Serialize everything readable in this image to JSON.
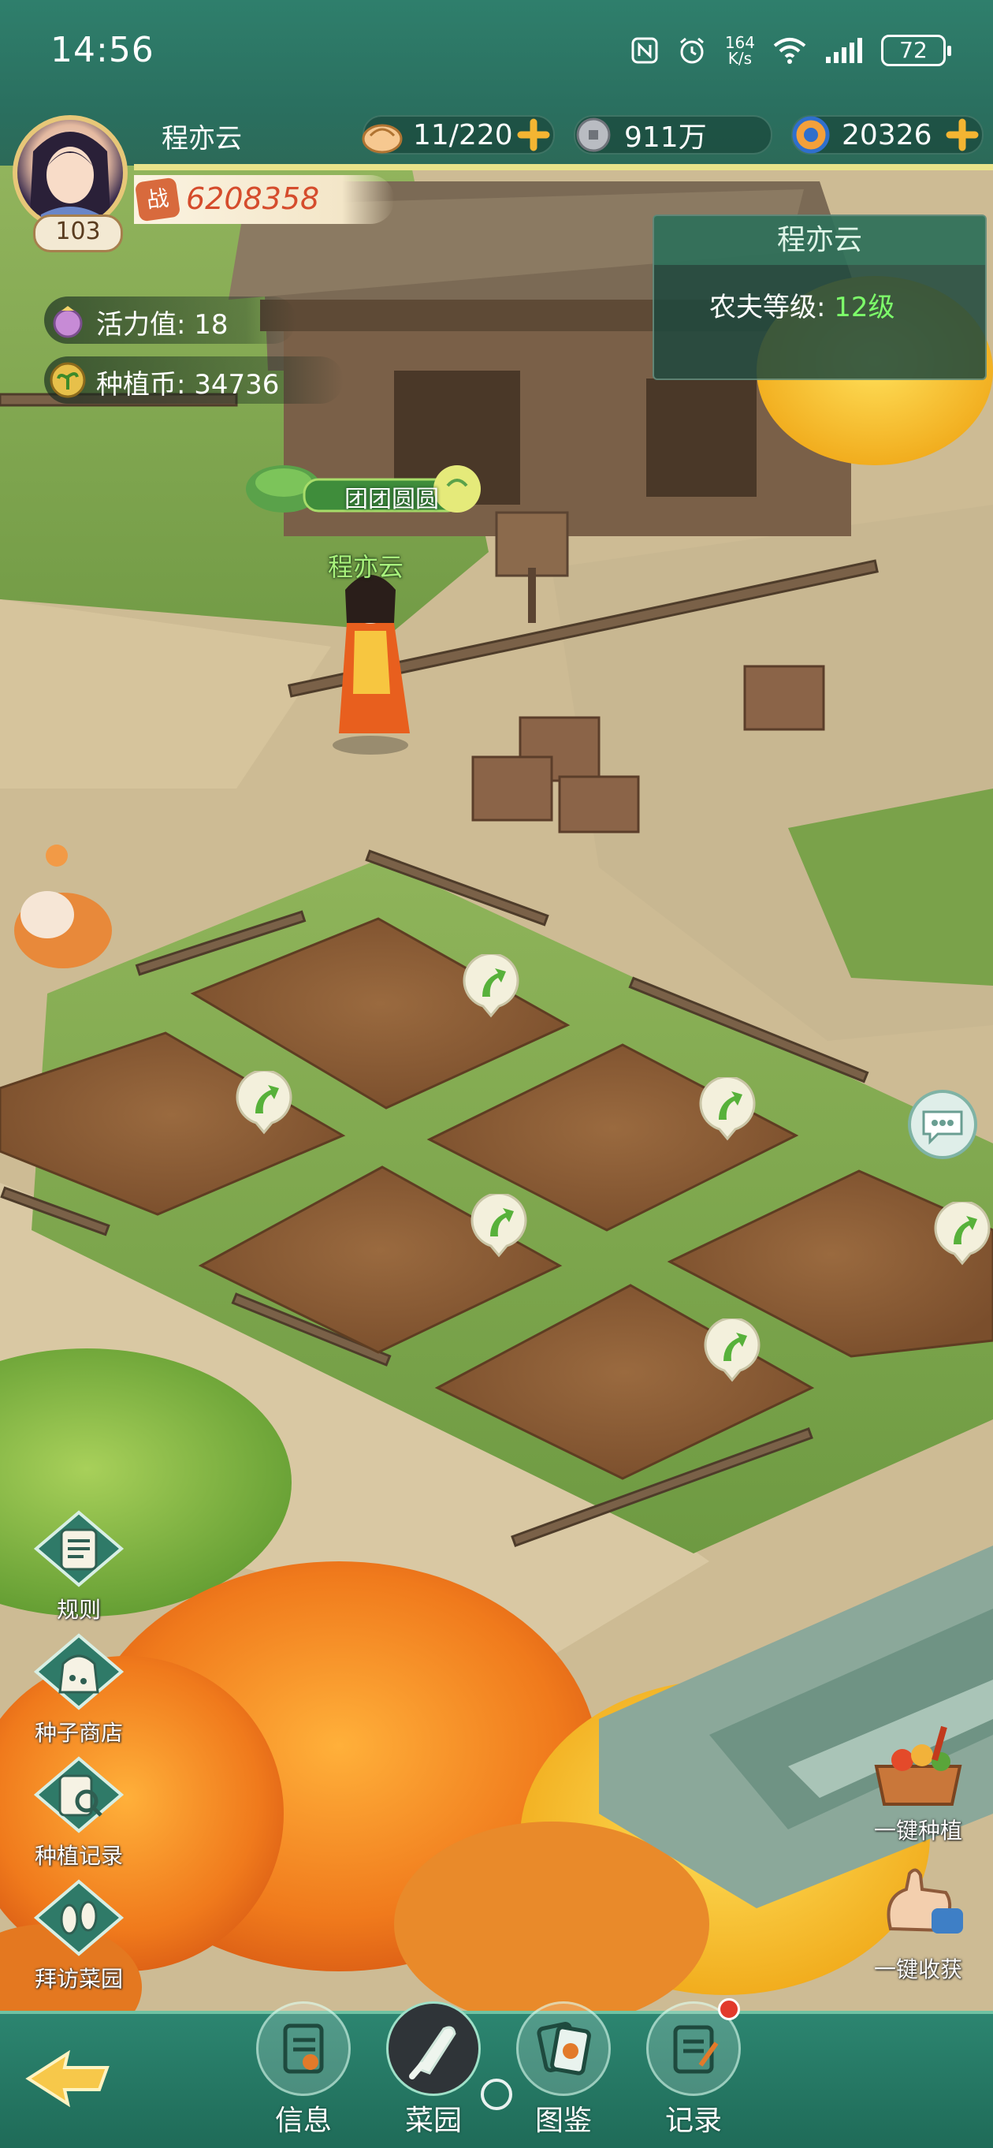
{
  "status_bar": {
    "time": "14:56",
    "net_speed_value": "164",
    "net_speed_unit": "K/s",
    "battery": "72"
  },
  "player": {
    "name": "程亦云",
    "level": "103",
    "power_icon_label": "战",
    "power": "6208358"
  },
  "resources": {
    "stamina_food": "11/220",
    "coins": "911万",
    "gems": "20326"
  },
  "stats": {
    "vitality": "活力值: 18",
    "plant_coins": "种植币: 34736"
  },
  "farmer_card": {
    "name": "程亦云",
    "level_label": "农夫等级:",
    "level_value": "12级"
  },
  "scene": {
    "guild_name": "团团圆圆",
    "character_name": "程亦云"
  },
  "left_menu": [
    {
      "label": "规则",
      "icon": "rules-scroll-icon"
    },
    {
      "label": "种子商店",
      "icon": "seed-bag-icon"
    },
    {
      "label": "种植记录",
      "icon": "magnifier-record-icon"
    },
    {
      "label": "拜访菜园",
      "icon": "footprints-icon"
    }
  ],
  "right_menu": [
    {
      "label": "一键种植",
      "icon": "planting-basket-icon"
    },
    {
      "label": "一键收获",
      "icon": "harvest-hand-icon"
    }
  ],
  "bottom_nav": [
    {
      "label": "信息",
      "active": false
    },
    {
      "label": "菜园",
      "active": true
    },
    {
      "label": "图鉴",
      "active": false
    },
    {
      "label": "记录",
      "active": false,
      "badge": true
    }
  ],
  "colors": {
    "teal_bar": "#2a6f5f",
    "farmer_level_green": "#7dff6a",
    "power_red": "#d54c2c",
    "soil": "#8a5a34"
  }
}
